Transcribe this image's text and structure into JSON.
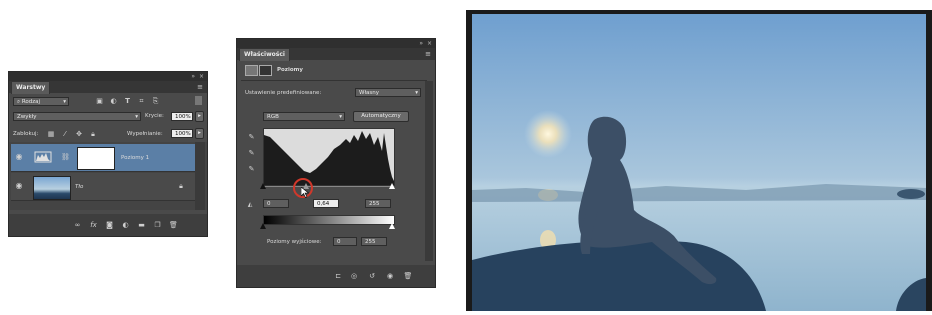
{
  "layers": {
    "title": "Warstwy",
    "filter": "Rodzaj",
    "blend_mode": "Zwykły",
    "opacity_label": "Krycie:",
    "opacity_value": "100%",
    "lock_label": "Zablokuj:",
    "fill_label": "Wypełnianie:",
    "fill_value": "100%",
    "rows": [
      {
        "name": "Poziomy 1"
      },
      {
        "name": "Tło"
      }
    ],
    "footer_icons": [
      "link-icon",
      "fx-icon",
      "mask-icon",
      "adjustment-icon",
      "group-icon",
      "new-layer-icon",
      "trash-icon"
    ]
  },
  "properties": {
    "title": "Właściwości",
    "header": "Poziomy",
    "preset_label": "Ustawienie predefiniowane:",
    "preset_value": "Własny",
    "channel": "RGB",
    "auto_button": "Automatyczny",
    "input_black": "0",
    "input_gamma": "0,64",
    "input_white": "255",
    "output_label": "Poziomy wyjściowe:",
    "output_black": "0",
    "output_white": "255",
    "footer_icons": [
      "clip-icon",
      "visibility-preview-icon",
      "reset-icon",
      "eye-icon",
      "trash-icon"
    ]
  },
  "photo": {
    "colors": {
      "sky_top": "#6f9fcf",
      "sky_bottom": "#c8dce8",
      "sea": "#8fb4cd",
      "rock": "#27425e"
    }
  },
  "colors": {
    "panel": "#4a4a4a",
    "panel_dark": "#2f2f2f",
    "selected_row": "#5b7fa6",
    "highlight": "#d0382b"
  }
}
